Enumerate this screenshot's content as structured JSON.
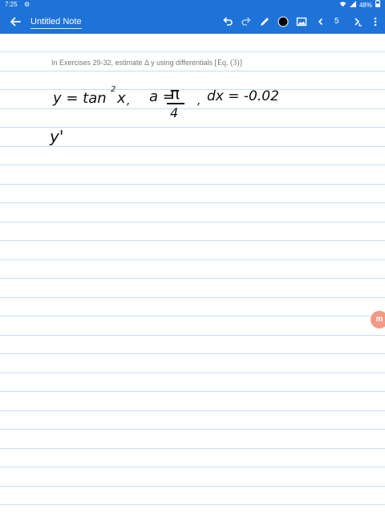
{
  "status_bar": {
    "time": "7:25",
    "battery": "48%",
    "icons": [
      "settings-icon",
      "wifi-icon",
      "signal-icon",
      "battery-icon"
    ]
  },
  "app_bar": {
    "title": "Untitled Note",
    "page_number": "5",
    "background_color": "#1e73d8",
    "selected_pen_color": "#000000",
    "tools": [
      "back-icon",
      "undo-icon",
      "redo-icon",
      "pen-icon",
      "color-swatch",
      "image-icon",
      "prev-page-icon",
      "next-page-icon",
      "more-icon"
    ]
  },
  "note": {
    "question_text": "In Exercises 29-32, estimate",
    "question_delta": "Δ y",
    "question_mid": "using differentials",
    "question_eq": "[Eq. (3)]",
    "handwriting": {
      "y_eq": "y = tan",
      "power": "2",
      "x": "x",
      "comma1": ",",
      "a_eq": "a =",
      "pi": "π",
      "four": "4",
      "comma2": ",",
      "dx": "dx = -0.02",
      "y_prime": "y'"
    }
  },
  "fab_label": "m"
}
